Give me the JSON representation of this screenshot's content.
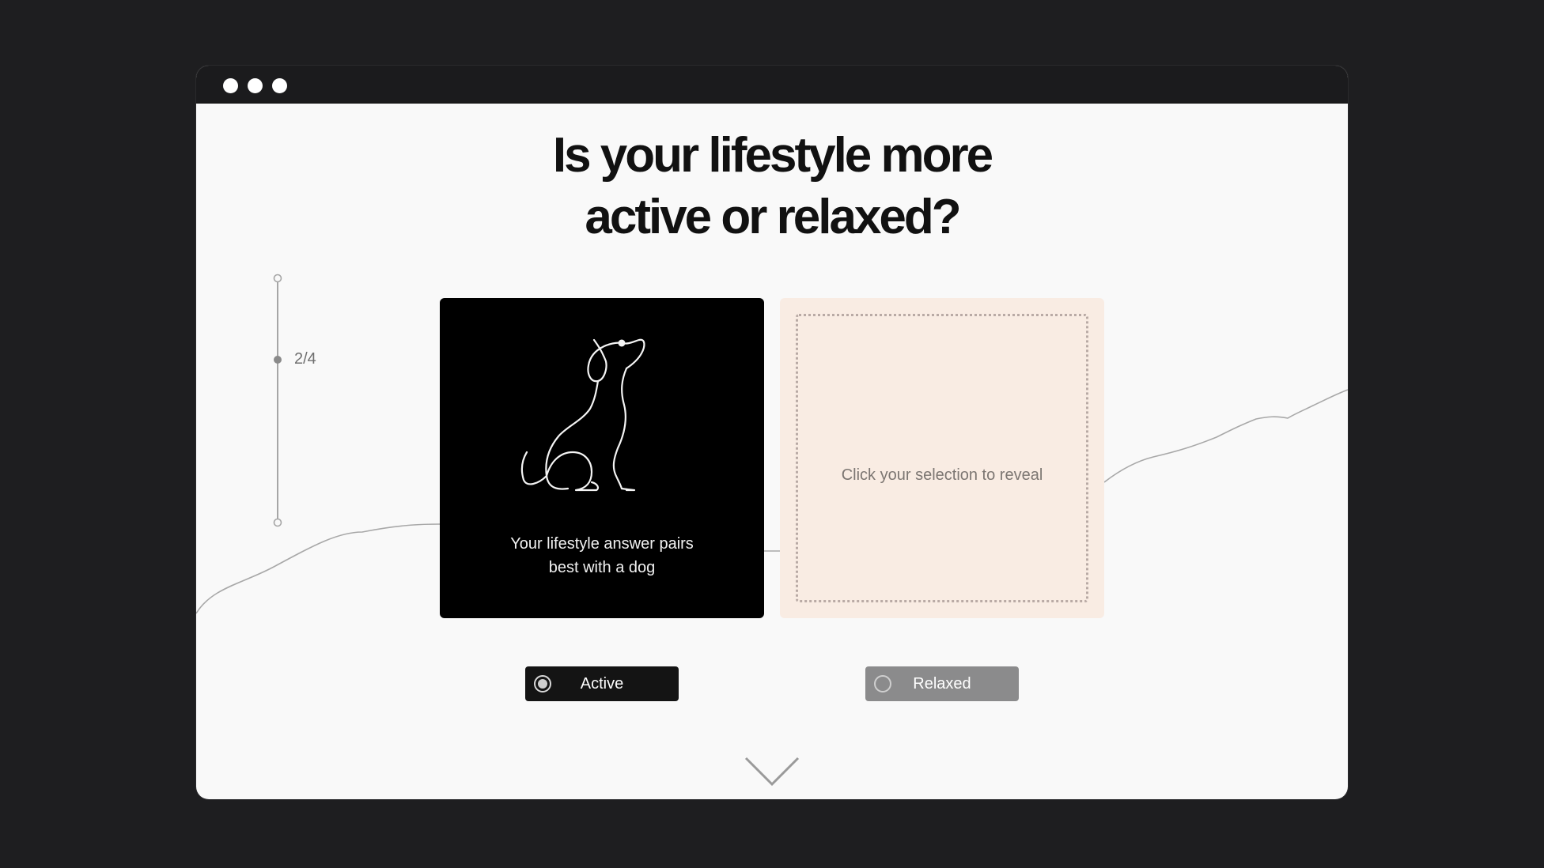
{
  "window": {
    "controls": [
      "window-dot",
      "window-dot",
      "window-dot"
    ]
  },
  "question": {
    "line1": "Is your lifestyle more",
    "line2": "active or relaxed?"
  },
  "progress": {
    "label": "2/4",
    "current": 2,
    "total": 4
  },
  "result_card": {
    "icon": "dog-line-icon",
    "caption_line1": "Your lifestyle answer pairs",
    "caption_line2": "best with a dog"
  },
  "hidden_card": {
    "prompt": "Click your selection to reveal"
  },
  "options": [
    {
      "label": "Active",
      "selected": true
    },
    {
      "label": "Relaxed",
      "selected": false
    }
  ],
  "scroll_hint": {
    "icon": "chevron-down-icon"
  },
  "colors": {
    "background": "#1e1e20",
    "window": "#f9f9f9",
    "selected_card": "#000000",
    "hidden_card": "#f9ece3",
    "active_button": "#141414",
    "inactive_button": "#8b8b8c"
  }
}
